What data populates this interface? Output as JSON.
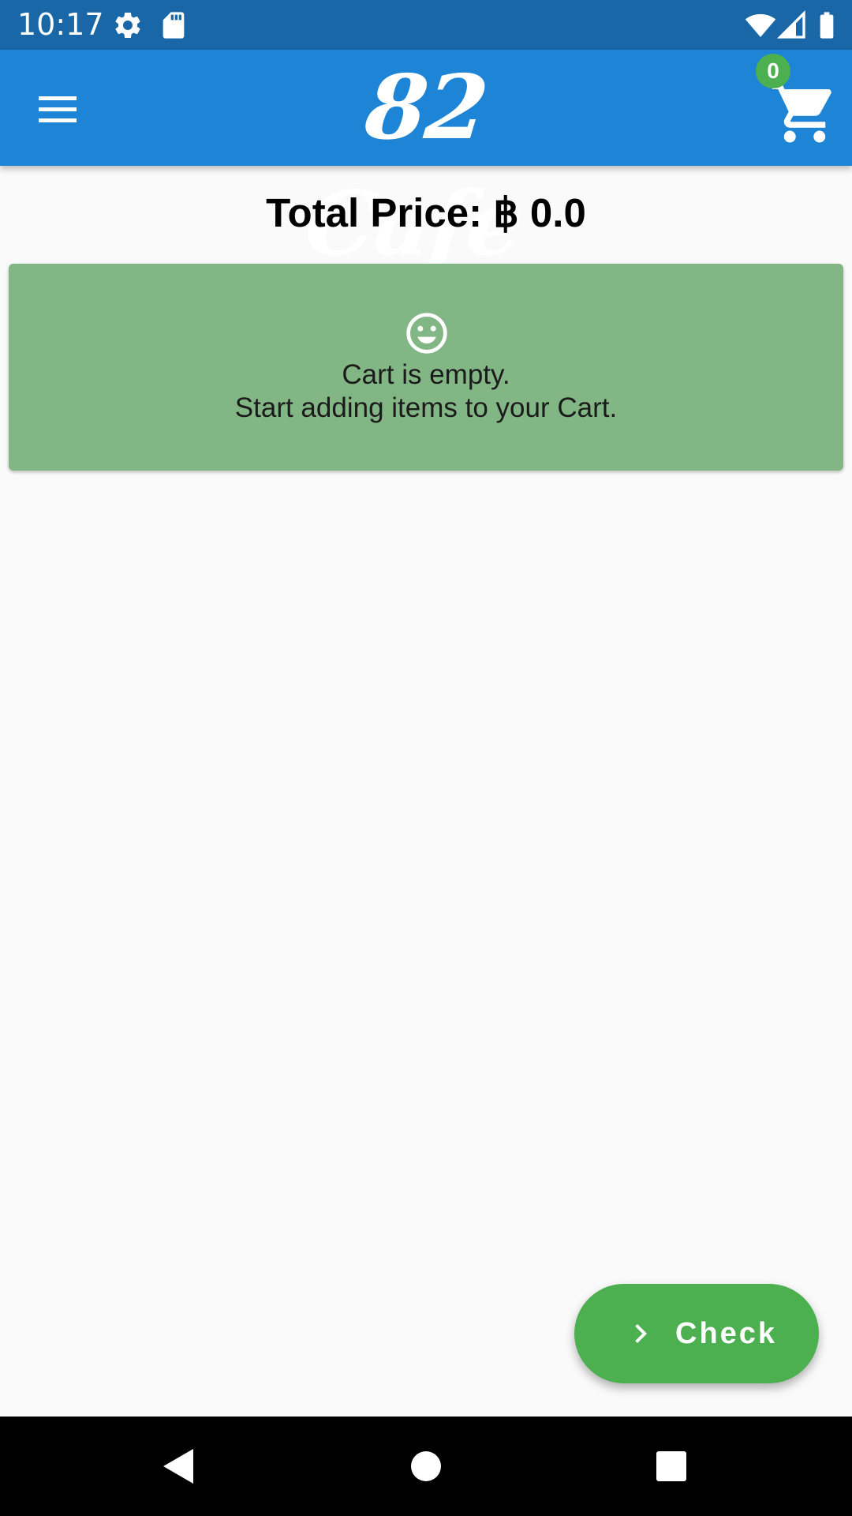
{
  "status_bar": {
    "time": "10:17",
    "icons": [
      "settings-icon",
      "sd-card-icon",
      "wifi-icon",
      "signal-icon",
      "battery-icon"
    ]
  },
  "app_bar": {
    "title": "82 Cafe",
    "menu_icon": "hamburger-menu-icon",
    "cart_icon": "shopping-cart-icon",
    "cart_count": "0"
  },
  "total": {
    "label": "Total Price: ฿ 0.0"
  },
  "empty_cart": {
    "icon": "smile-icon",
    "line1": "Cart is empty.",
    "line2": "Start adding items to your Cart."
  },
  "fab": {
    "icon": "chevron-right-icon",
    "label": "Check"
  },
  "nav_bar": {
    "buttons": [
      "back-icon",
      "home-icon",
      "recents-icon"
    ]
  },
  "colors": {
    "status_bar": "#1967a6",
    "app_bar": "#1e84d6",
    "badge": "#4caf50",
    "card": "#83b685",
    "fab": "#4caf50",
    "background": "#fafafa"
  }
}
